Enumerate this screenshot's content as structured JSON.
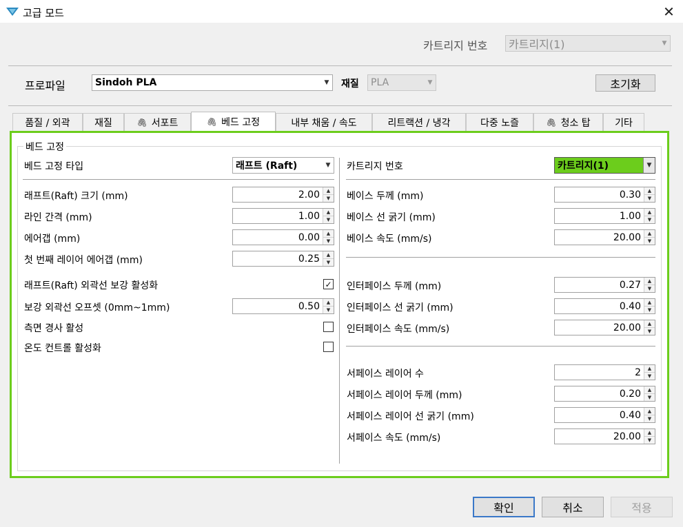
{
  "window": {
    "title": "고급 모드"
  },
  "top": {
    "cartridge_label": "카트리지 번호",
    "cartridge_value": "카트리지(1)"
  },
  "profile": {
    "label": "프로파일",
    "value": "Sindoh PLA",
    "material_label": "재질",
    "material_value": "PLA",
    "reset_label": "초기화"
  },
  "tabs": [
    {
      "label": "품질 / 외곽",
      "icon": ""
    },
    {
      "label": "재질",
      "icon": ""
    },
    {
      "label": "서포트",
      "icon": "paperclip-icon"
    },
    {
      "label": "베드 고정",
      "icon": "paperclip-icon"
    },
    {
      "label": "내부 채움 / 속도",
      "icon": ""
    },
    {
      "label": "리트랙션 / 냉각",
      "icon": ""
    },
    {
      "label": "다중 노즐",
      "icon": ""
    },
    {
      "label": "청소 탑",
      "icon": "paperclip-icon"
    },
    {
      "label": "기타",
      "icon": ""
    }
  ],
  "active_tab": "베드 고정",
  "group": {
    "title": "베드 고정",
    "type_label": "베드 고정 타입",
    "type_value": "래프트 (Raft)",
    "cartridge_label": "카트리지 번호",
    "cartridge_value": "카트리지(1)",
    "highlight_color": "#6ccd1c"
  },
  "left_fields": [
    {
      "label": "래프트(Raft) 크기 (mm)",
      "value": "2.00"
    },
    {
      "label": "라인 간격 (mm)",
      "value": "1.00"
    },
    {
      "label": "에어갭 (mm)",
      "value": "0.00"
    },
    {
      "label": "첫 번째 레이어 에어갭 (mm)",
      "value": "0.25"
    }
  ],
  "left_options": [
    {
      "label": "래프트(Raft) 외곽선 보강 활성화",
      "checked": true
    },
    {
      "label": "보강 외곽선 오프셋 (0mm~1mm)",
      "value": "0.50"
    },
    {
      "label": "측면 경사 활성",
      "checked": false
    },
    {
      "label": "온도 컨트롤 활성화",
      "checked": false
    }
  ],
  "base_fields": [
    {
      "label": "베이스 두께 (mm)",
      "value": "0.30"
    },
    {
      "label": "베이스 선 굵기 (mm)",
      "value": "1.00"
    },
    {
      "label": "베이스 속도 (mm/s)",
      "value": "20.00"
    }
  ],
  "interface_fields": [
    {
      "label": "인터페이스 두께 (mm)",
      "value": "0.27"
    },
    {
      "label": "인터페이스 선 굵기 (mm)",
      "value": "0.40"
    },
    {
      "label": "인터페이스 속도 (mm/s)",
      "value": "20.00"
    }
  ],
  "surface_fields": [
    {
      "label": "서페이스 레이어 수",
      "value": "2"
    },
    {
      "label": "서페이스 레이어 두께 (mm)",
      "value": "0.20"
    },
    {
      "label": "서페이스 레이어 선 굵기 (mm)",
      "value": "0.40"
    },
    {
      "label": "서페이스 속도 (mm/s)",
      "value": "20.00"
    }
  ],
  "footer": {
    "ok_label": "확인",
    "cancel_label": "취소",
    "apply_label": "적용"
  }
}
